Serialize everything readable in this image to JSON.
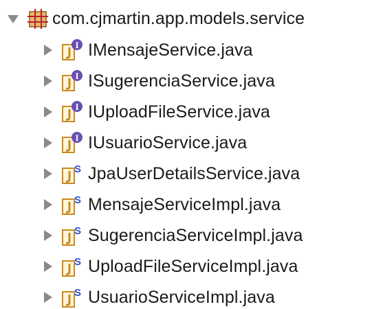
{
  "package": {
    "name": "com.cjmartin.app.models.service",
    "icon": "package-icon",
    "expanded": true
  },
  "files": [
    {
      "name": "IMensajeService.java",
      "kind": "interface",
      "icon": "java-interface-icon"
    },
    {
      "name": "ISugerenciaService.java",
      "kind": "interface",
      "icon": "java-interface-icon"
    },
    {
      "name": "IUploadFileService.java",
      "kind": "interface",
      "icon": "java-interface-icon"
    },
    {
      "name": "IUsuarioService.java",
      "kind": "interface",
      "icon": "java-interface-icon"
    },
    {
      "name": "JpaUserDetailsService.java",
      "kind": "service",
      "icon": "java-service-icon"
    },
    {
      "name": "MensajeServiceImpl.java",
      "kind": "service",
      "icon": "java-service-icon"
    },
    {
      "name": "SugerenciaServiceImpl.java",
      "kind": "service",
      "icon": "java-service-icon"
    },
    {
      "name": "UploadFileServiceImpl.java",
      "kind": "service",
      "icon": "java-service-icon"
    },
    {
      "name": "UsuarioServiceImpl.java",
      "kind": "service",
      "icon": "java-service-icon"
    }
  ],
  "colors": {
    "twisty": "#8a8a8a",
    "package_fill": "#d9a55a",
    "package_stroke": "#8b5a22",
    "java_file": "#c98a1f",
    "interface_badge": "#6a4fb3",
    "service_badge": "#2a4fd6"
  }
}
